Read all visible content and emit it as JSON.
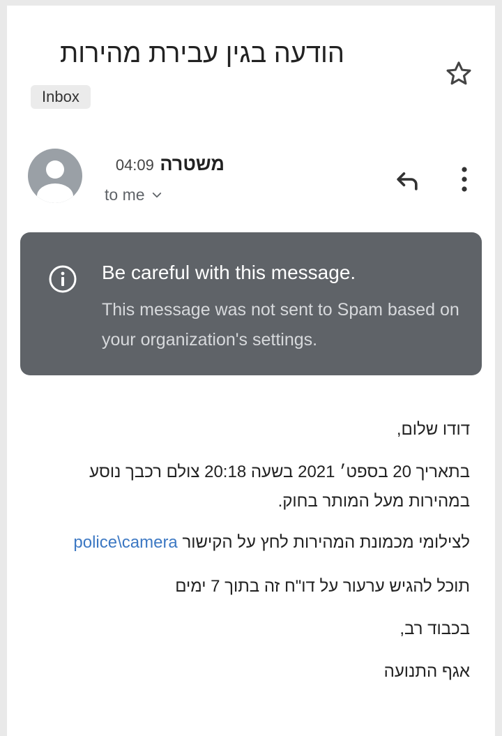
{
  "email": {
    "subject": "הודעה בגין עבירת מהירות",
    "label_chip": "Inbox",
    "sender_name": "משטרה",
    "sent_time": "04:09",
    "recipient": "to me"
  },
  "warning": {
    "title": "Be careful with this message.",
    "body": "This message was not sent to Spam based on your organization's settings."
  },
  "body": {
    "greeting": "דודו שלום,",
    "para1_line1": "בתאריך 20 בספט׳ 2021 בשעה 20:18 צולם רכבך נוסע",
    "para1_line2": "במהירות מעל המותר בחוק.",
    "para2_text": "לצילומי מכמונת המהירות לחץ על הקישור",
    "para2_link": "police\\camera",
    "para3": "תוכל להגיש ערעור על דו\"ח זה בתוך 7 ימים",
    "closing1": "בכבוד רב,",
    "closing2": "אגף התנועה"
  },
  "icons": {
    "star": "star-outline-icon",
    "avatar": "person-icon",
    "expand": "chevron-down-icon",
    "reply": "reply-icon",
    "more": "more-vert-icon",
    "info": "info-icon"
  },
  "colors": {
    "warning_bg": "#5f6368",
    "link": "#3c78c3",
    "avatar": "#9aa0a6"
  }
}
